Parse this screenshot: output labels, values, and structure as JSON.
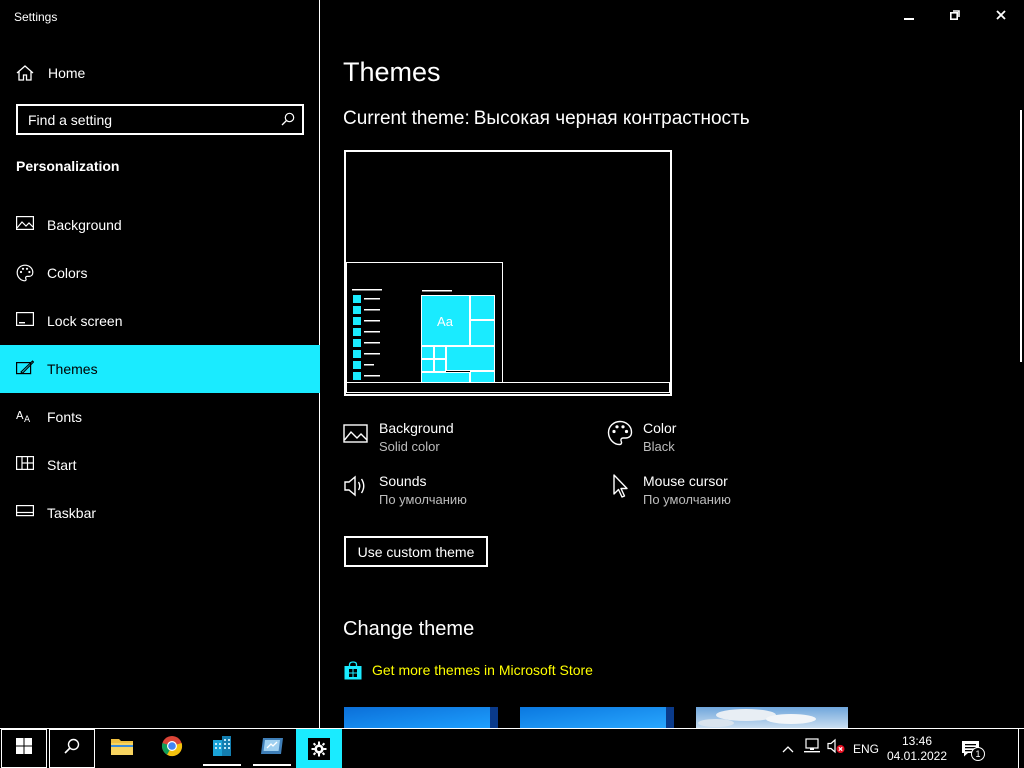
{
  "app": {
    "title": "Settings"
  },
  "window_controls": {
    "minimize": "minimize-icon",
    "restore": "restore-icon",
    "close": "close-icon"
  },
  "sidebar": {
    "home_label": "Home",
    "search_placeholder": "Find a setting",
    "section_label": "Personalization",
    "items": [
      {
        "label": "Background",
        "icon": "picture-icon"
      },
      {
        "label": "Colors",
        "icon": "palette-icon"
      },
      {
        "label": "Lock screen",
        "icon": "lock-screen-icon"
      },
      {
        "label": "Themes",
        "icon": "themes-icon",
        "active": true
      },
      {
        "label": "Fonts",
        "icon": "fonts-icon"
      },
      {
        "label": "Start",
        "icon": "start-icon"
      },
      {
        "label": "Taskbar",
        "icon": "taskbar-icon"
      }
    ]
  },
  "main": {
    "title": "Themes",
    "current_theme_label": "Current theme:",
    "current_theme_value": "Высокая черная контрастность",
    "preview_tile_text": "Aa",
    "properties": {
      "background": {
        "title": "Background",
        "value": "Solid color"
      },
      "color": {
        "title": "Color",
        "value": "Black"
      },
      "sounds": {
        "title": "Sounds",
        "value": "По умолчанию"
      },
      "mouse_cursor": {
        "title": "Mouse cursor",
        "value": "По умолчанию"
      }
    },
    "custom_theme_button": "Use custom theme",
    "change_theme_title": "Change theme",
    "store_link": "Get more themes in Microsoft Store"
  },
  "taskbar": {
    "language": "ENG",
    "time": "13:46",
    "date": "04.01.2022",
    "notification_count": "1"
  },
  "colors": {
    "accent": "#1aebff",
    "link": "#ffff00",
    "background": "#000000",
    "foreground": "#ffffff"
  }
}
